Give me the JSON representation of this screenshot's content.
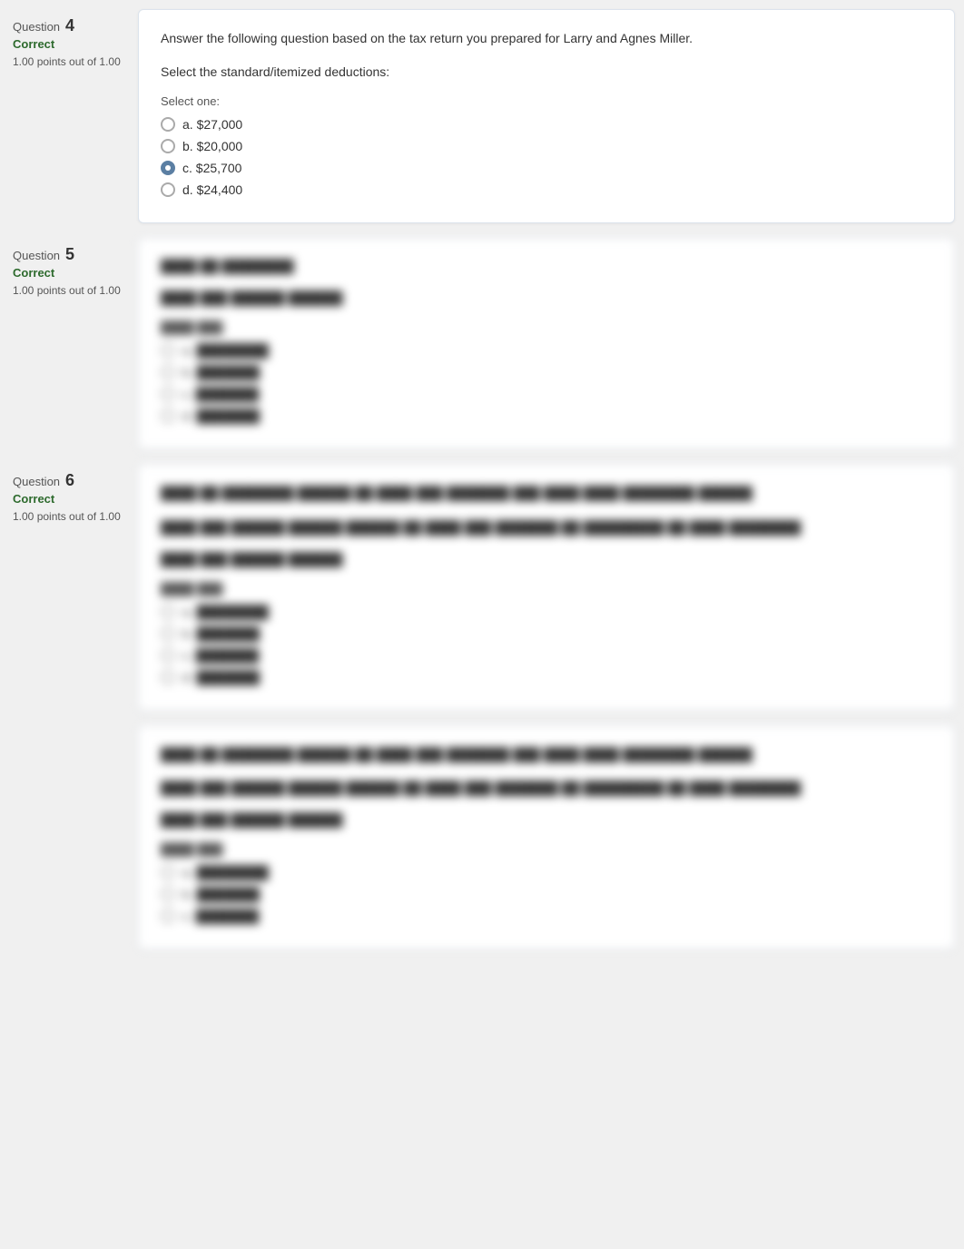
{
  "questions": [
    {
      "id": "q4",
      "label": "Question",
      "number": "4",
      "status": "Correct",
      "points": "1.00 points out of 1.00",
      "context": "Answer the following question based on the tax return you prepared for Larry and Agnes Miller.",
      "text": "Select the standard/itemized deductions:",
      "select_one": "Select one:",
      "options": [
        {
          "letter": "a.",
          "value": "$27,000",
          "selected": false
        },
        {
          "letter": "b.",
          "value": "$20,000",
          "selected": false
        },
        {
          "letter": "c.",
          "value": "$25,700",
          "selected": true
        },
        {
          "letter": "d.",
          "value": "$24,400",
          "selected": false
        }
      ],
      "blurred": false
    },
    {
      "id": "q5",
      "label": "Question",
      "number": "5",
      "status": "Correct",
      "points": "1.00 points out of 1.00",
      "context": "",
      "text": "████ ██ ████████",
      "sub_text": "████ ███ ██████ ██████:",
      "select_one": "████ ███:",
      "options": [
        {
          "letter": "a.",
          "value": "█ ███████",
          "selected": false
        },
        {
          "letter": "b.",
          "value": "█ █████ ██",
          "selected": false
        },
        {
          "letter": "c.",
          "value": "█ ██████",
          "selected": false
        },
        {
          "letter": "d.",
          "value": "█ █████ ██",
          "selected": false
        }
      ],
      "blurred": true
    },
    {
      "id": "q6",
      "label": "Question",
      "number": "6",
      "status": "Correct",
      "points": "1.00 points out of 1.00",
      "context": "████ ██ ████████ ██████ ██ ████ ███ ███████ ███ ████ ████ ████████ ██████",
      "text": "████ ███ ██████ ██████ ██████ ██ ████ ███ ███████ ██ █████████ ██ ████ ████████",
      "sub_text": "████ ███ ██████ ██████:",
      "select_one": "████ ███:",
      "options": [
        {
          "letter": "a.",
          "value": "█ ███████",
          "selected": false
        },
        {
          "letter": "b.",
          "value": "█ █████ ██",
          "selected": false
        },
        {
          "letter": "c.",
          "value": "█ ██████",
          "selected": false
        },
        {
          "letter": "d.",
          "value": "█ █████ ██",
          "selected": false
        }
      ],
      "blurred": true
    },
    {
      "id": "q7",
      "label": "",
      "number": "",
      "status": "",
      "points": "",
      "context": "████ ██ ████████ ██████ ██ ████ ███ ███████ ███ ████ ████ ████████ ██████",
      "text": "████ ███ ██████ ██████ ██████ ██ ████ ███ ███████ ██ █████████ ██ ████ ████████",
      "sub_text": "████ ███ ██████ ██████:",
      "select_one": "████ ███:",
      "options": [
        {
          "letter": "a.",
          "value": "█ ███████",
          "selected": false
        },
        {
          "letter": "b.",
          "value": "█ █████ ██",
          "selected": false
        },
        {
          "letter": "c.",
          "value": "█ ██████",
          "selected": false
        }
      ],
      "blurred": true,
      "partial": true
    }
  ]
}
